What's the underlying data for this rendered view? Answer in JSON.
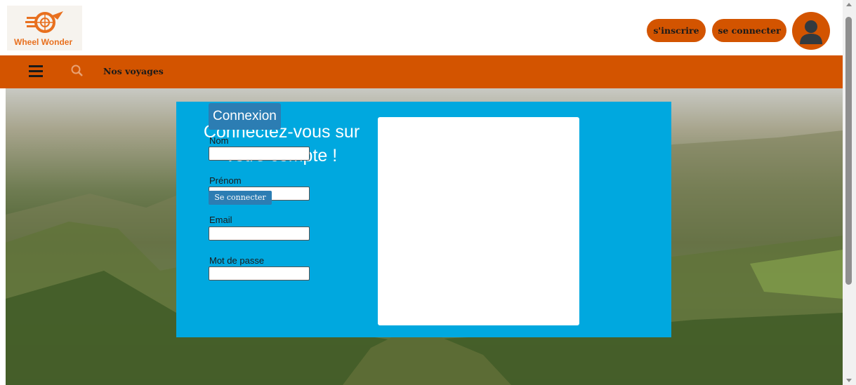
{
  "brand": {
    "name": "Wheel Wonder",
    "logo_icon": "wheel-logo-icon",
    "accent": "#d35400"
  },
  "header": {
    "signup_label": "s'inscrire",
    "login_label": "se connecter",
    "avatar_icon": "user-avatar-icon"
  },
  "nav": {
    "menu_icon": "hamburger-menu-icon",
    "search_icon": "search-icon",
    "link_label": "Nos voyages"
  },
  "hero": {
    "panel_color": "#00a8df",
    "title_line1": "Connectez-vous sur",
    "title_line2": "votre compte !"
  },
  "form": {
    "legend": "Connexion",
    "fields": [
      {
        "label": "Nom",
        "value": ""
      },
      {
        "label": "Prénom",
        "value": ""
      },
      {
        "label": "Email",
        "value": ""
      },
      {
        "label": "Mot de passe",
        "value": ""
      }
    ],
    "submit_label": "Se connecter",
    "button_color": "#2c7db3"
  }
}
